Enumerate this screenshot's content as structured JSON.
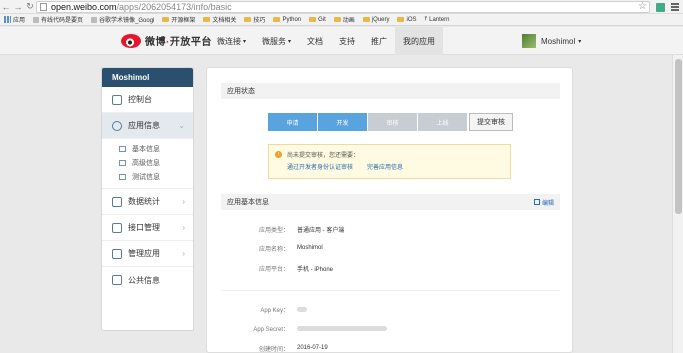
{
  "browser": {
    "url_host": "open.weibo.com",
    "url_path": "/apps/2062054173/info/basic",
    "bookmarks": [
      {
        "label": "应用",
        "icon": "apps-icon"
      },
      {
        "label": "有线代码是要页",
        "icon": "page-icon"
      },
      {
        "label": "谷歌学术镜像_Googl",
        "icon": "page-icon"
      },
      {
        "label": "开源框架",
        "icon": "folder-icon"
      },
      {
        "label": "文档相关",
        "icon": "folder-icon"
      },
      {
        "label": "技巧",
        "icon": "folder-icon"
      },
      {
        "label": "Python",
        "icon": "folder-icon"
      },
      {
        "label": "Git",
        "icon": "folder-icon"
      },
      {
        "label": "动画",
        "icon": "folder-icon"
      },
      {
        "label": "jQuery",
        "icon": "folder-icon"
      },
      {
        "label": "iOS",
        "icon": "folder-icon"
      },
      {
        "label": "Lantern",
        "icon": "pin-icon"
      }
    ]
  },
  "header": {
    "logo_text": "微博",
    "logo_sep": "·",
    "logo_suffix": "开放平台",
    "nav": [
      {
        "label": "微连接",
        "caret": "▾"
      },
      {
        "label": "微服务",
        "caret": "▾"
      },
      {
        "label": "文档",
        "caret": ""
      },
      {
        "label": "支持",
        "caret": ""
      },
      {
        "label": "推广",
        "caret": ""
      },
      {
        "label": "我的应用",
        "caret": ""
      }
    ],
    "username": "Moshimol",
    "user_caret": "▾"
  },
  "sidebar": {
    "title": "Moshimol",
    "items": [
      {
        "label": "控制台",
        "icon": "dashboard-icon"
      },
      {
        "label": "应用信息",
        "icon": "gear-icon"
      },
      {
        "label": "数据统计",
        "icon": "chart-icon"
      },
      {
        "label": "接口管理",
        "icon": "api-icon"
      },
      {
        "label": "管理应用",
        "icon": "manage-icon"
      },
      {
        "label": "公共信息",
        "icon": "info-icon"
      }
    ],
    "sub_items": [
      {
        "label": "基本信息"
      },
      {
        "label": "高级信息"
      },
      {
        "label": "测试信息"
      }
    ],
    "arrow": "›",
    "active_arrow": "⌄"
  },
  "status_section": {
    "title": "应用状态",
    "steps": [
      {
        "label": "申请",
        "state": "done"
      },
      {
        "label": "开发",
        "state": "done"
      },
      {
        "label": "审核",
        "state": "todo"
      },
      {
        "label": "上线",
        "state": "todo"
      }
    ],
    "submit_label": "提交审核",
    "notice_text": "尚未提交审核，您还需要：",
    "notice_links": [
      "通过开发者身份认证审核",
      "完善应用信息"
    ]
  },
  "basic_section": {
    "title": "应用基本信息",
    "edit_label": "编辑",
    "rows": [
      {
        "label": "应用类型：",
        "value": "普通应用  -  客户端"
      },
      {
        "label": "应用名称：",
        "value": "Moshimol"
      },
      {
        "label": "应用平台：",
        "value": "手机  -  iPhone"
      }
    ],
    "key_rows": [
      {
        "label": "App Key："
      },
      {
        "label": "App Secret："
      },
      {
        "label": "创建时间：",
        "value": "2016-07-19"
      }
    ]
  },
  "colors": {
    "step_done": "#59a3de",
    "step_todo": "#c7cdd2",
    "sidebar_head": "#2b4f6e",
    "link": "#2a6ab0"
  }
}
